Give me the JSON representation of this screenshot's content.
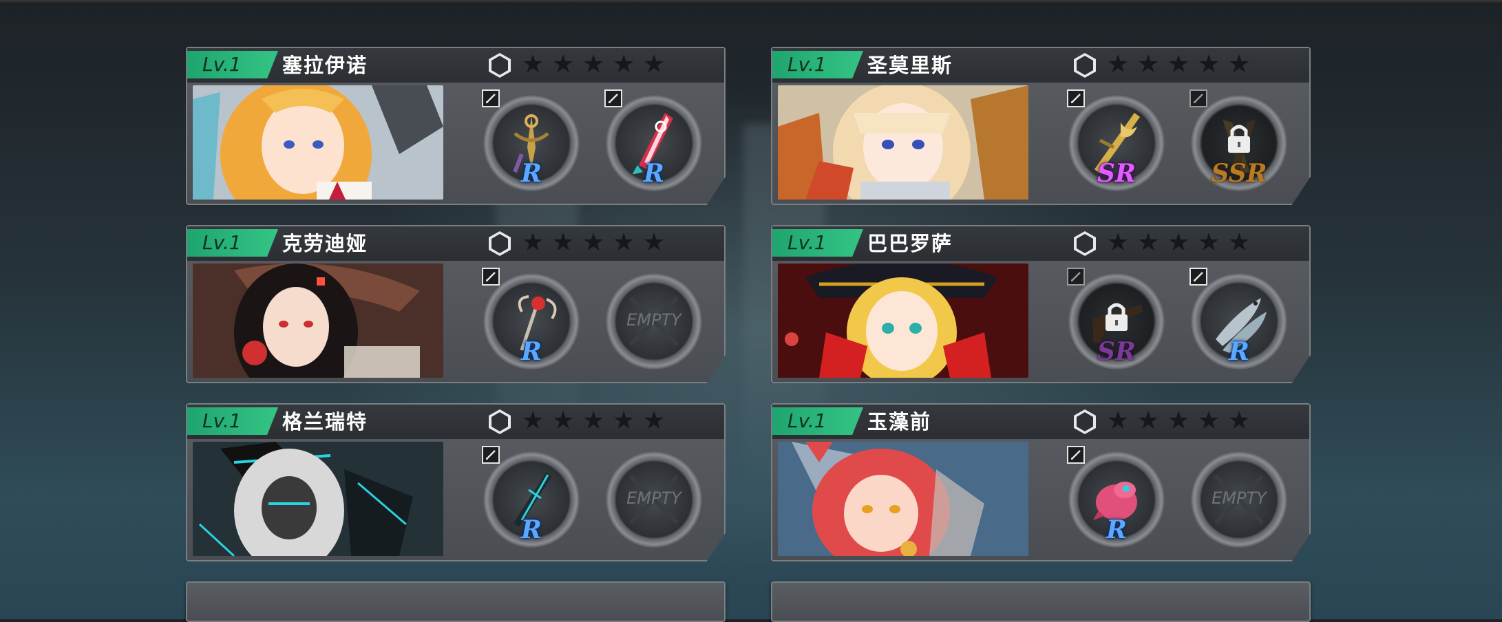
{
  "characters": [
    {
      "level": "Lv.1",
      "name": "塞拉伊诺",
      "portrait_palette": {
        "hair": "#f0b040",
        "bg": "#c7d0d8",
        "accent": "#c41e3a"
      },
      "slots": [
        {
          "state": "equipped",
          "rarity": "R",
          "item_icon": "anchor-dagger-icon"
        },
        {
          "state": "equipped",
          "rarity": "R",
          "item_icon": "red-blade-icon"
        }
      ]
    },
    {
      "level": "Lv.1",
      "name": "圣莫里斯",
      "portrait_palette": {
        "hair": "#f3dcb5",
        "bg": "#d9c7a8",
        "accent": "#d04a2a"
      },
      "slots": [
        {
          "state": "equipped",
          "rarity": "SR",
          "item_icon": "golden-spear-icon"
        },
        {
          "state": "locked",
          "rarity": "SSR",
          "item_icon": "bronze-blades-icon"
        }
      ]
    },
    {
      "level": "Lv.1",
      "name": "克劳迪娅",
      "portrait_palette": {
        "hair": "#1a1414",
        "bg": "#5a3a30",
        "accent": "#c83030"
      },
      "slots": [
        {
          "state": "equipped",
          "rarity": "R",
          "item_icon": "rose-staff-icon"
        },
        {
          "state": "empty",
          "label": "EMPTY"
        }
      ]
    },
    {
      "level": "Lv.1",
      "name": "巴巴罗萨",
      "portrait_palette": {
        "hair": "#f2c84a",
        "bg": "#5e1212",
        "accent": "#d4a020"
      },
      "slots": [
        {
          "state": "locked",
          "rarity": "SR",
          "item_icon": "flintlock-pistol-icon"
        },
        {
          "state": "equipped",
          "rarity": "R",
          "item_icon": "fish-icon"
        }
      ]
    },
    {
      "level": "Lv.1",
      "name": "格兰瑞特",
      "portrait_palette": {
        "hair": "#e8e8e8",
        "bg": "#2a3a40",
        "accent": "#29d3e0"
      },
      "slots": [
        {
          "state": "equipped",
          "rarity": "R",
          "item_icon": "cyan-sword-icon"
        },
        {
          "state": "empty",
          "label": "EMPTY"
        }
      ]
    },
    {
      "level": "Lv.1",
      "name": "玉藻前",
      "portrait_palette": {
        "hair": "#e04a4a",
        "bg": "#4a6a8a",
        "accent": "#e9b040"
      },
      "slots": [
        {
          "state": "equipped",
          "rarity": "R",
          "item_icon": "pink-creature-icon"
        },
        {
          "state": "empty",
          "label": "EMPTY"
        }
      ]
    }
  ],
  "star_glyph": "★",
  "colors": {
    "level_badge": "#2bb57a",
    "rarity_R": "#5aa8ff",
    "rarity_SR": "#e35cff",
    "rarity_SSR": "#b87a22"
  }
}
